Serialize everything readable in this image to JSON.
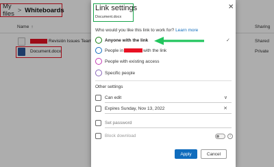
{
  "breadcrumb": {
    "root": "My files",
    "separator": ">",
    "current": "Whiteboards"
  },
  "file_list": {
    "columns": {
      "name": "Name",
      "sharing": "Sharing"
    },
    "rows": [
      {
        "name": "Revisión Issues Teams.wh",
        "sharing": "Shared"
      },
      {
        "name": "Document.docx",
        "sharing": "Private"
      }
    ]
  },
  "dialog": {
    "title": "Link settings",
    "subtitle": "Document.docx",
    "question": "Who would you like this link to work for?",
    "learn_more": "Learn more",
    "options": [
      {
        "label": "Anyone with the link",
        "icon": "globe-icon",
        "selected": true
      },
      {
        "label_prefix": "People in",
        "label_suffix": "with the link",
        "icon": "org-icon"
      },
      {
        "label": "People with existing access",
        "icon": "group-icon"
      },
      {
        "label": "Specific people",
        "icon": "person-icon"
      }
    ],
    "other_settings": "Other settings",
    "permission": "Can edit",
    "expires_label": "Expires",
    "expires_date": "Sunday, Nov 13, 2022",
    "password_placeholder": "Set password",
    "block_download": "Block download",
    "apply": "Apply",
    "cancel": "Cancel"
  },
  "colors": {
    "accent": "#0f6cbd",
    "annotation_red": "#e81123",
    "annotation_green": "#16a34a",
    "arrow_green": "#22c55e"
  }
}
